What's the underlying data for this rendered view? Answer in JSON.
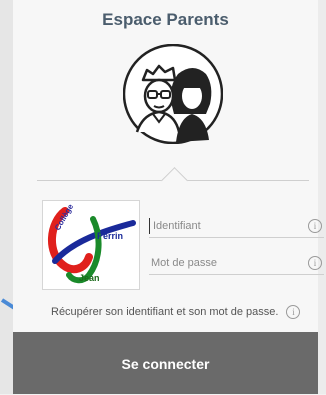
{
  "page": {
    "title": "Espace Parents"
  },
  "login": {
    "identifier_placeholder": "Identifiant",
    "password_placeholder": "Mot de passe",
    "recover_link": "Récupérer son identifiant et son mot de passe.",
    "connect_label": "Se connecter"
  },
  "logo": {
    "text_lines": [
      "Collège",
      "Perrin",
      "Jean"
    ]
  },
  "icons": {
    "avatar": "parents-avatar-icon",
    "info": "info-icon",
    "arrow": "arrow-pointer-icon"
  },
  "colors": {
    "title": "#4b5d6d",
    "button_bg": "#6a6a6a",
    "accent_blue": "#3b7dd8"
  }
}
